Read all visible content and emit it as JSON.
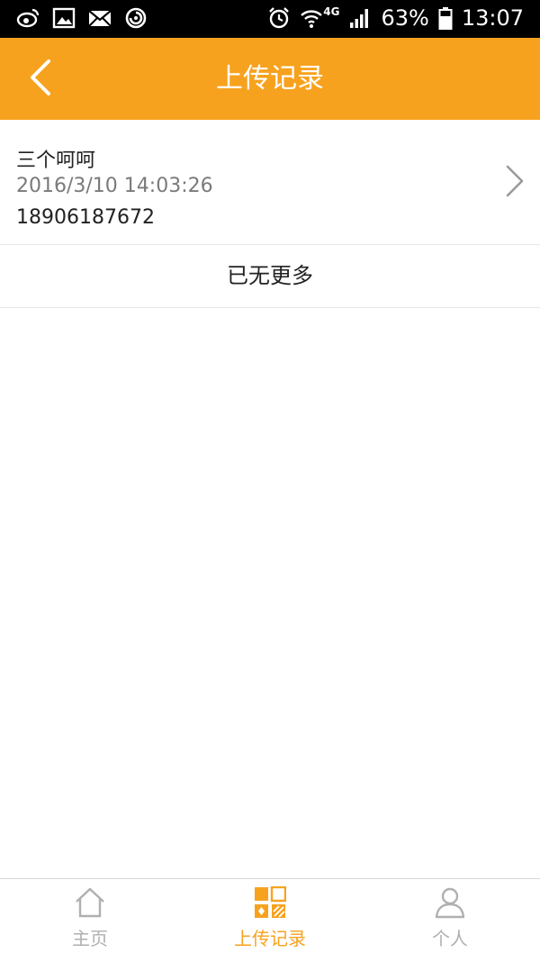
{
  "status_bar": {
    "battery_percent": "63%",
    "time": "13:07",
    "network": "4G",
    "icons": [
      "weibo-icon",
      "gallery-icon",
      "mail-icon",
      "sync-icon",
      "alarm-icon",
      "wifi-icon",
      "signal-icon",
      "battery-icon"
    ]
  },
  "header": {
    "title": "上传记录",
    "back_icon": "chevron-left-icon"
  },
  "records": [
    {
      "name": "三个呵呵",
      "datetime": "2016/3/10 14:03:26",
      "phone": "18906187672"
    }
  ],
  "list_footer": "已无更多",
  "tabs": [
    {
      "label": "主页",
      "icon": "home-icon",
      "active": false
    },
    {
      "label": "上传记录",
      "icon": "grid-icon",
      "active": true
    },
    {
      "label": "个人",
      "icon": "person-icon",
      "active": false
    }
  ],
  "colors": {
    "accent": "#F7A21E",
    "inactive_tab": "#b0b0b0",
    "secondary_text": "#7a7a7a"
  }
}
